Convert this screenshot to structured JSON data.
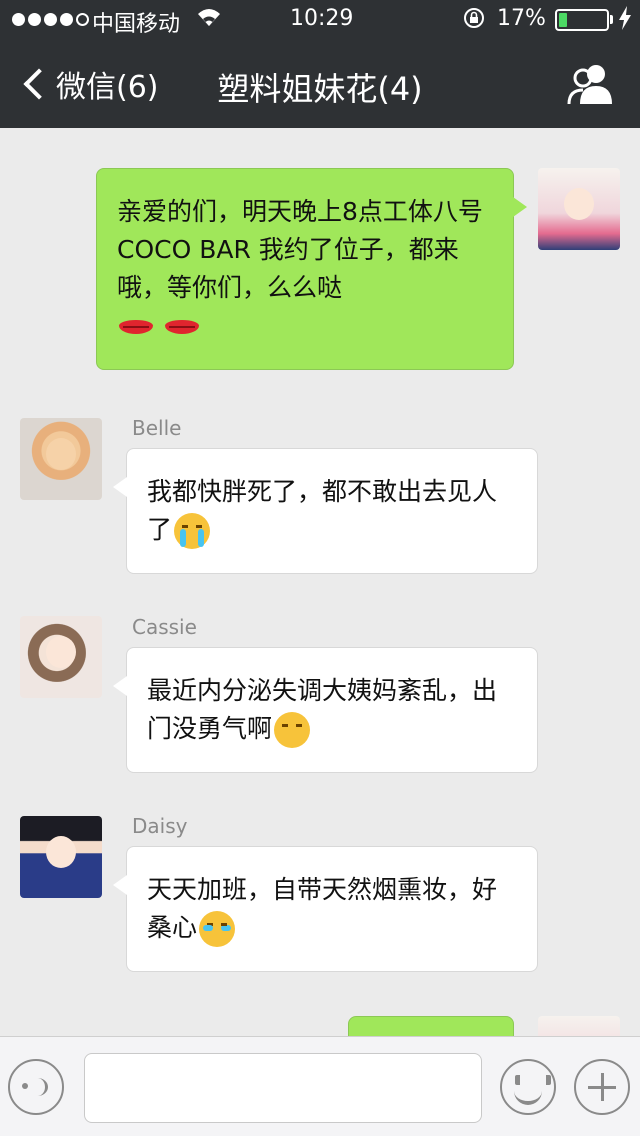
{
  "status_bar": {
    "carrier": "中国移动",
    "time": "10:29",
    "battery_percent": "17%",
    "battery_level": 0.17,
    "battery_color": "#4cd964",
    "signal_bars_filled": 4,
    "signal_bars_total": 5
  },
  "nav": {
    "back_label": "微信(6)",
    "title": "塑料姐妹花(4)",
    "group_icon": "group-members-icon"
  },
  "messages": [
    {
      "direction": "out",
      "text": "亲爱的们，明天晚上8点工体八号COCO BAR 我约了位子，都来哦，等你们，么么哒",
      "emoji": [
        "lips",
        "lips"
      ]
    },
    {
      "direction": "in",
      "sender": "Belle",
      "text": "我都快胖死了，都不敢出去见人了",
      "emoji": [
        "crying-face"
      ]
    },
    {
      "direction": "in",
      "sender": "Cassie",
      "text": "最近内分泌失调大姨妈紊乱，出门没勇气啊",
      "emoji": [
        "sad-face"
      ]
    },
    {
      "direction": "in",
      "sender": "Daisy",
      "text": "天天加班，自带天然烟熏妆，好桑心",
      "emoji": [
        "tears-face"
      ]
    }
  ],
  "toolbar": {
    "voice_icon": "voice-icon",
    "emoji_icon": "emoji-icon",
    "plus_icon": "plus-icon",
    "input_value": ""
  },
  "colors": {
    "header_bg": "#2e3134",
    "chat_bg": "#ebebeb",
    "outgoing_bubble": "#a0e75a",
    "incoming_bubble": "#ffffff"
  }
}
